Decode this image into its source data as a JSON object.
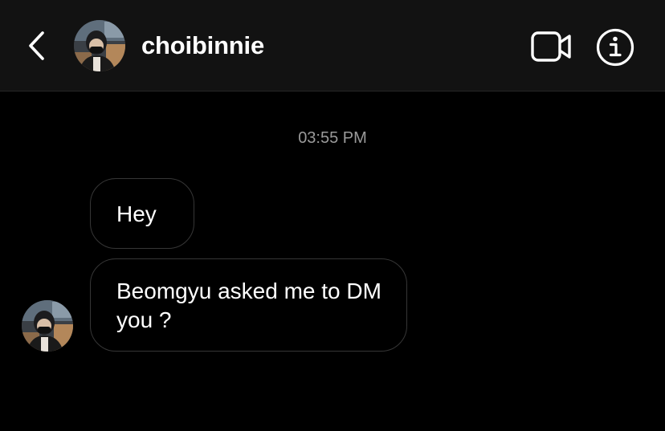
{
  "header": {
    "username": "choibinnie",
    "back_icon": "chevron-left-icon",
    "video_icon": "video-call-icon",
    "info_icon": "info-icon"
  },
  "conversation": {
    "timestamp": "03:55 PM",
    "messages": [
      {
        "text": "Hey"
      },
      {
        "text": "Beomgyu asked me to DM you ?"
      }
    ]
  },
  "colors": {
    "background": "#000000",
    "header_background": "#121212",
    "bubble_border": "#363636",
    "timestamp_text": "#9a9a9a",
    "text": "#ffffff"
  }
}
